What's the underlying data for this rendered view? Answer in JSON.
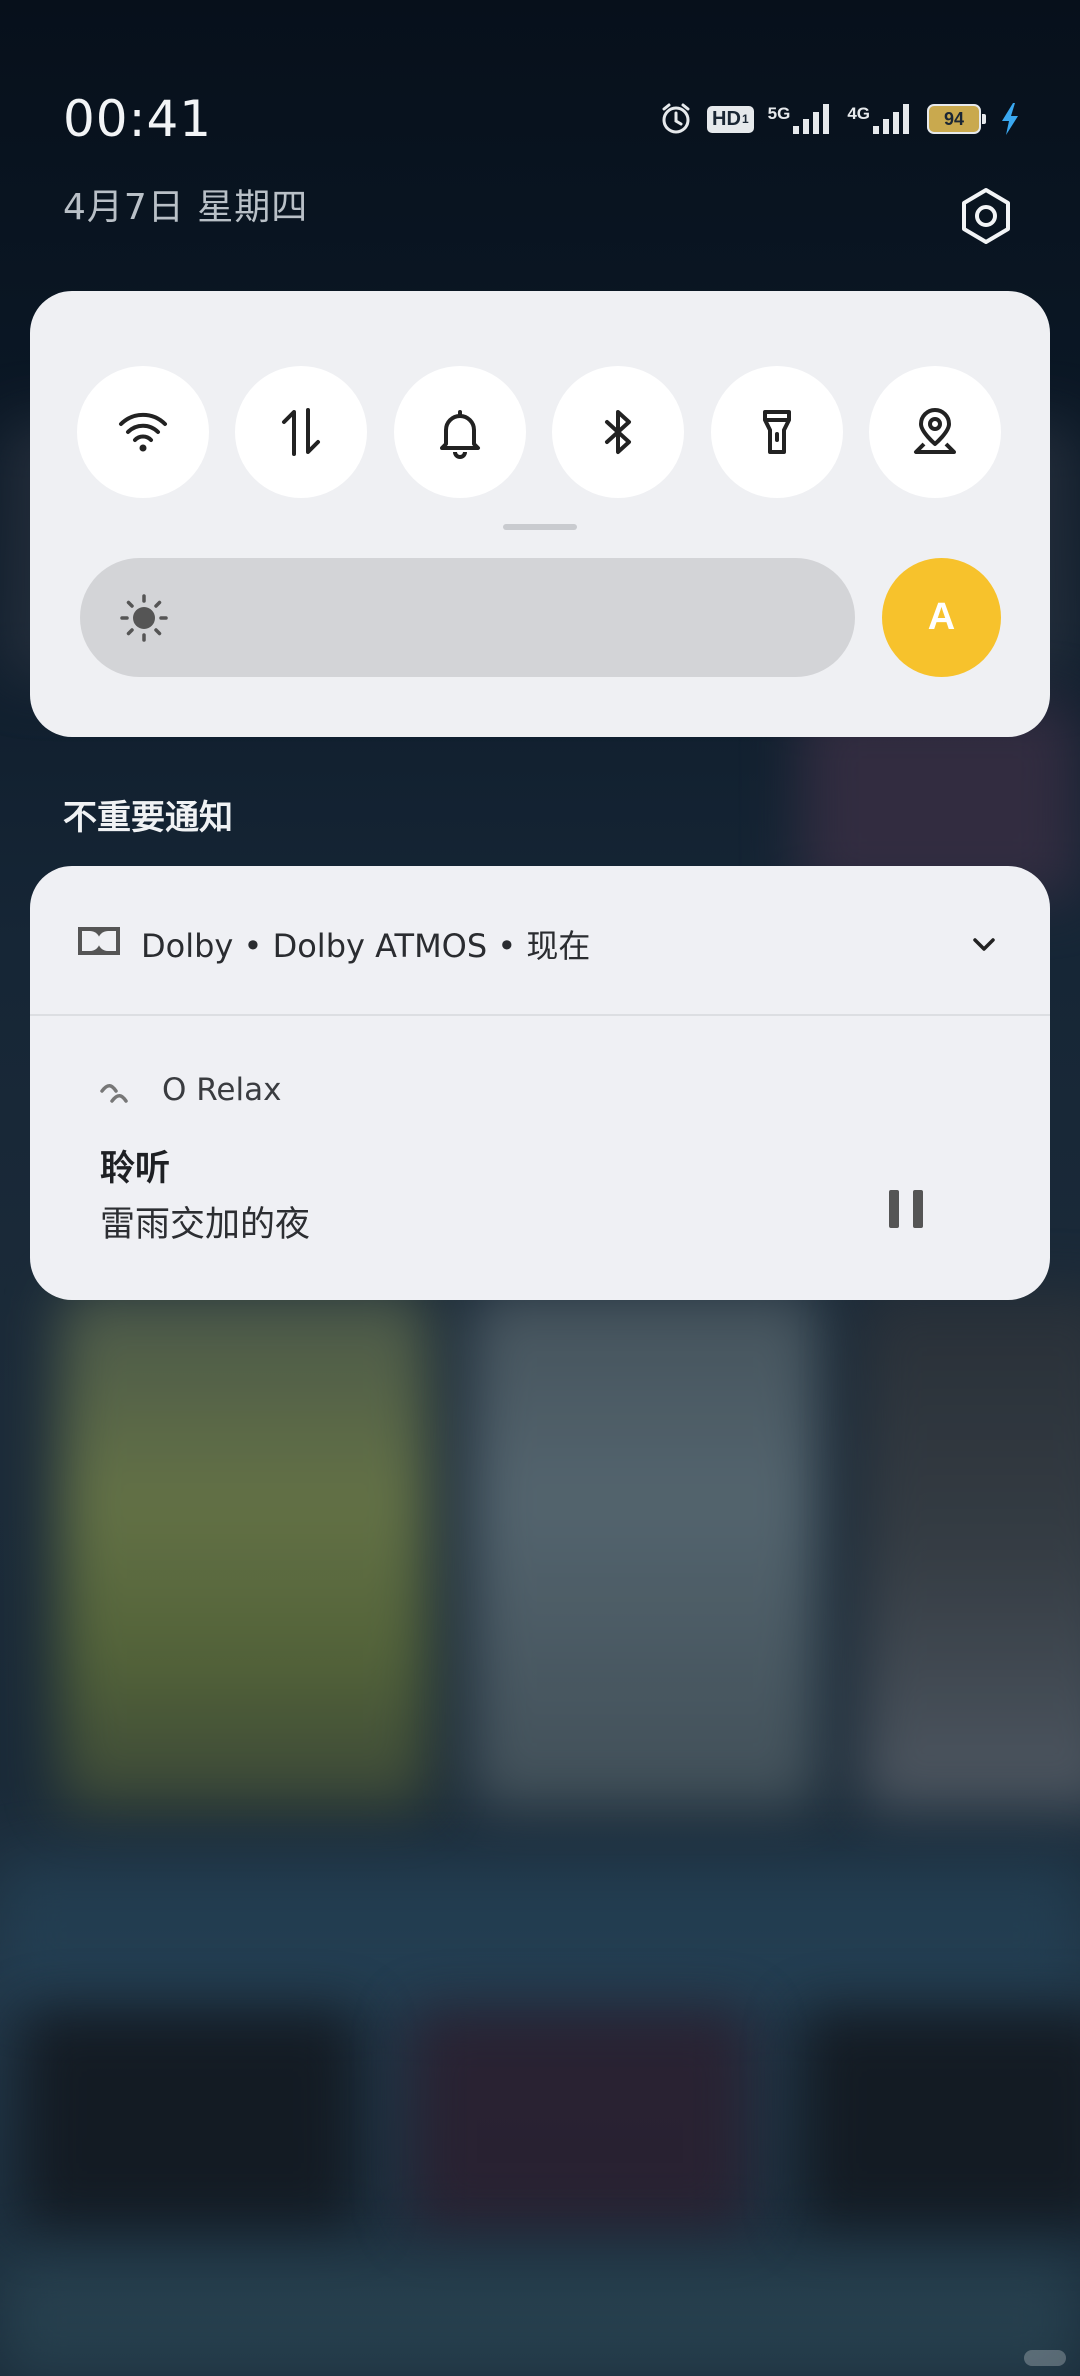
{
  "status_bar": {
    "time": "00:41",
    "date": "4月7日  星期四",
    "battery": "94",
    "network_5g": "5G",
    "network_4g": "4G",
    "hd_badge": "HD"
  },
  "quick_settings": {
    "toggles": [
      {
        "icon": "wifi-icon"
      },
      {
        "icon": "mobile-data-icon"
      },
      {
        "icon": "bell-icon"
      },
      {
        "icon": "bluetooth-icon"
      },
      {
        "icon": "flashlight-icon"
      },
      {
        "icon": "location-icon"
      }
    ],
    "auto_brightness_label": "A",
    "accent_color": "#f7c22c"
  },
  "notifications": {
    "section_title": "不重要通知",
    "header": "Dolby • Dolby ATMOS • 现在",
    "media": {
      "app_name": "O Relax",
      "title": "聆听",
      "subtitle": "雷雨交加的夜"
    }
  }
}
